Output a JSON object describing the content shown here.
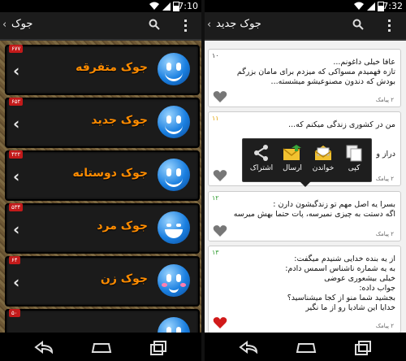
{
  "left": {
    "status_time": "7:10",
    "title": "جوک",
    "items": [
      {
        "badge": "۶۷۷",
        "label": "جوک متفرقه",
        "face": "smile"
      },
      {
        "badge": "۶۵۲",
        "label": "جوک جدید",
        "face": "smile"
      },
      {
        "badge": "۴۲۲",
        "label": "جوک دوستانه",
        "face": "smile"
      },
      {
        "badge": "۵۳۴",
        "label": "جوک مرد",
        "face": "laugh"
      },
      {
        "badge": "۶۴",
        "label": "جوک زن",
        "face": "blush"
      },
      {
        "badge": "۵۰",
        "label": "",
        "face": "smile"
      }
    ]
  },
  "right": {
    "status_time": "7:32",
    "title": "جوک جدید",
    "cards": [
      {
        "num": "۱۰",
        "num_color": "#333333",
        "text": "عافا خیلی داغونم...\nتازه فهمیدم مسواکی که میزدم برای مامان بزرگم\nبودش که دندون مصنوعیشو میشسته...",
        "meta": "۲ پیامک",
        "liked": false
      },
      {
        "num": "۱۱",
        "num_color": "#e0a000",
        "text": "من در کشوری زندگی میکنم که...\n\n\nدراز و",
        "meta": "۲ پیامک",
        "liked": false
      },
      {
        "num": "۱۲",
        "num_color": "#2a9a2a",
        "text": "بسرا یه اصل مهم تو زندگیشون دارن :\nاگه دستت به چیزی نمیرسه، پات حتما بهش میرسه",
        "meta": "۲ پیامک",
        "liked": false
      },
      {
        "num": "۱۳",
        "num_color": "#2a9a2a",
        "text": "از یه بنده خدایی شنیدم میگفت:\nبه یه شماره ناشناس اسمس دادم:\nخیلی بیشعوری عوضی\nجواب داده:\nبجشید شما منو از کجا میشناسید؟\nخدایا این شادیا رو از ما نگیر",
        "meta": "۲ پیامک",
        "liked": true
      }
    ],
    "popup": [
      {
        "label": "کپی",
        "icon": "copy-icon"
      },
      {
        "label": "خواندن",
        "icon": "read-mail-icon"
      },
      {
        "label": "ارسال",
        "icon": "send-mail-icon"
      },
      {
        "label": "اشتراک",
        "icon": "share-icon"
      }
    ]
  },
  "colors": {
    "badge": "#c31a1a",
    "label": "#ff8c00",
    "heart_off": "#777777",
    "heart_on": "#d11a1a"
  }
}
